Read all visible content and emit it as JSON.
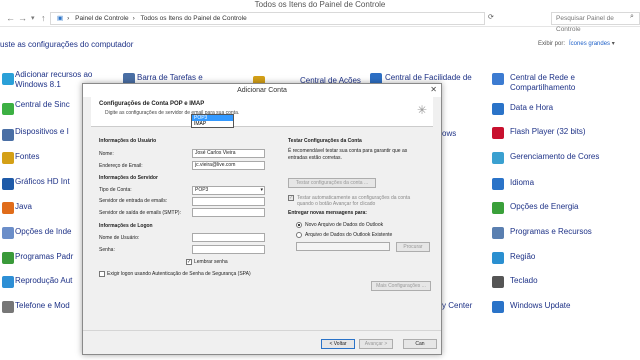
{
  "window": {
    "title": "Todos os Itens do Painel de Controle",
    "breadcrumb": [
      "Painel de Controle",
      "Todos os Itens do Painel de Controle"
    ],
    "search_placeholder": "Pesquisar Painel de Controle",
    "heading": "uste as configurações do computador",
    "view_by_label": "Exibir por:",
    "view_by_value": "Ícones grandes"
  },
  "items": [
    {
      "label": "Adicionar recursos ao Windows 8.1",
      "icon": "windows-icon",
      "color": "#2aa0d8"
    },
    {
      "label": "Central de Sinc",
      "icon": "sync-icon",
      "color": "#3cb043"
    },
    {
      "label": "Dispositivos e I",
      "icon": "devices-icon",
      "color": "#4a6fa5"
    },
    {
      "label": "Fontes",
      "icon": "fonts-icon",
      "color": "#d4a017"
    },
    {
      "label": "Gráficos HD Int",
      "icon": "graphics-icon",
      "color": "#1e5aa8"
    },
    {
      "label": "Java",
      "icon": "java-icon",
      "color": "#e06c1a"
    },
    {
      "label": "Opções de Inde",
      "icon": "index-icon",
      "color": "#6b8ec9"
    },
    {
      "label": "Programas Padr",
      "icon": "programs-icon",
      "color": "#3a9a3a"
    },
    {
      "label": "Reprodução Aut",
      "icon": "autoplay-icon",
      "color": "#2d8fd5"
    },
    {
      "label": "Telefone e Mod",
      "icon": "phone-icon",
      "color": "#777777"
    },
    {
      "label": "Barra de Tarefas e",
      "icon": "taskbar-icon",
      "color": "#4a6fa5"
    },
    {
      "label": "Central de Ações",
      "icon": "action-center-icon",
      "color": "#d4a017"
    },
    {
      "label": "Central de Facilidade de Acesso",
      "icon": "ease-of-access-icon",
      "color": "#2d6fc4"
    },
    {
      "label": "ows",
      "icon": "windows-icon",
      "color": "#2d6fc4"
    },
    {
      "label": "y Center",
      "icon": "mobility-icon",
      "color": "#2d6fc4"
    },
    {
      "label": "Central de Rede e Compartilhamento",
      "icon": "network-icon",
      "color": "#3c7bd1"
    },
    {
      "label": "Data e Hora",
      "icon": "clock-icon",
      "color": "#2a73c8"
    },
    {
      "label": "Flash Player (32 bits)",
      "icon": "flash-icon",
      "color": "#c8102e"
    },
    {
      "label": "Gerenciamento de Cores",
      "icon": "color-icon",
      "color": "#3aa0d0"
    },
    {
      "label": "Idioma",
      "icon": "language-icon",
      "color": "#2a73c8"
    },
    {
      "label": "Opções de Energia",
      "icon": "power-icon",
      "color": "#3aa03a"
    },
    {
      "label": "Programas e Recursos",
      "icon": "programs-features-icon",
      "color": "#5a7fb0"
    },
    {
      "label": "Região",
      "icon": "region-icon",
      "color": "#2a8fd0"
    },
    {
      "label": "Teclado",
      "icon": "keyboard-icon",
      "color": "#555555"
    },
    {
      "label": "Windows Update",
      "icon": "update-icon",
      "color": "#2a73c8"
    }
  ],
  "dialog": {
    "title": "Adicionar Conta",
    "header_title": "Configurações de Conta POP e IMAP",
    "header_subtitle": "Digite as configurações de servidor de email para sua conta.",
    "user_section": "Informações do Usuário",
    "name_label": "Nome:",
    "name_value": "José Carlos Vieira",
    "email_label": "Endereço de Email:",
    "email_value": "jc.vieira@live.com",
    "server_section": "Informações do Servidor",
    "account_type_label": "Tipo de Conta:",
    "account_type_value": "POP3",
    "account_type_options": [
      "POP3",
      "IMAP"
    ],
    "incoming_label": "Servidor de entrada de emails:",
    "outgoing_label": "Servidor de saída de emails (SMTP):",
    "logon_section": "Informações de Logon",
    "username_label": "Nome de Usuário:",
    "password_label": "Senha:",
    "remember_password": "Lembrar senha",
    "spa_label": "Exigir logon usando Autenticação de Senha de Segurança (SPA)",
    "test_section": "Testar Configurações da Conta",
    "test_desc": "É recomendável testar sua conta para garantir que as entradas estão corretas.",
    "test_button": "Testar configurações da conta ...",
    "auto_test": "Testar automaticamente as configurações da conta quando o botão Avançar for clicado",
    "deliver_section": "Entregar novas mensagens para:",
    "new_data_file": "Novo Arquivo de Dados do Outlook",
    "existing_data_file": "Arquivo de Dados do Outlook Existente",
    "browse_button": "Procurar",
    "more_settings": "Mais Configurações ...",
    "back_button": "< Voltar",
    "next_button": "Avançar >",
    "cancel_button": "Can"
  }
}
